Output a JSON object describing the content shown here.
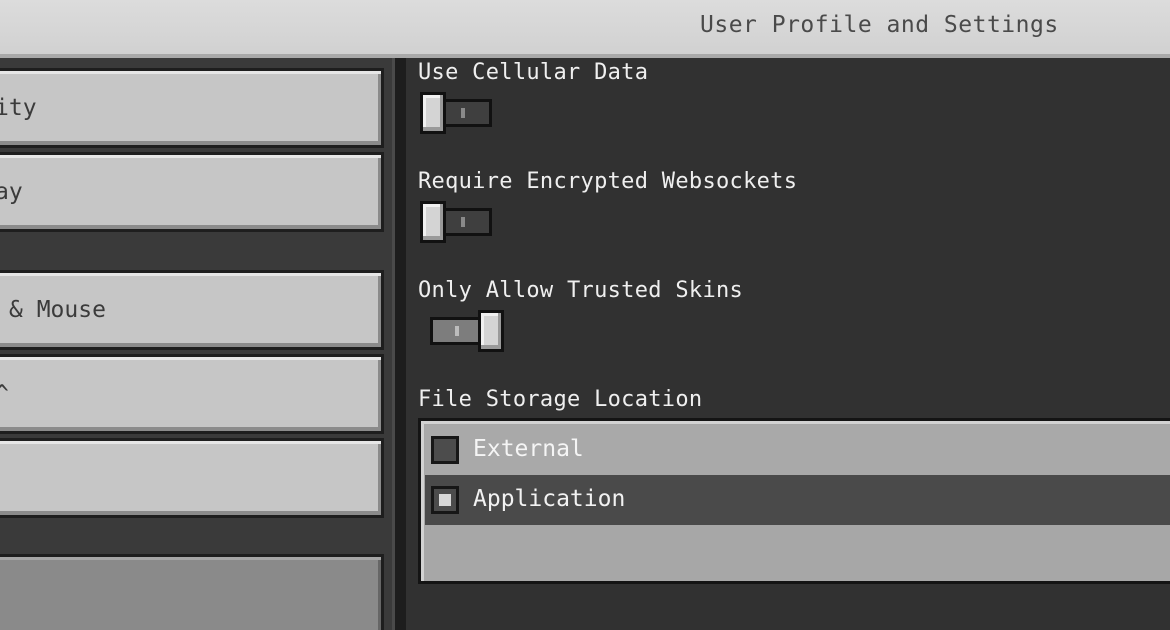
{
  "header": {
    "title": "User Profile and Settings"
  },
  "sidebar": {
    "items": [
      {
        "label": "ity"
      },
      {
        "label": "ay"
      },
      {
        "label": "& Mouse"
      },
      {
        "label": "^"
      },
      {
        "label": ""
      },
      {
        "label": ""
      }
    ]
  },
  "settings": {
    "use_cellular_data": {
      "label": "Use Cellular Data",
      "enabled": false
    },
    "require_encrypted_websockets": {
      "label": "Require Encrypted Websockets",
      "enabled": false
    },
    "only_allow_trusted_skins": {
      "label": "Only Allow Trusted Skins",
      "enabled": true
    },
    "file_storage_location": {
      "label": "File Storage Location",
      "options": [
        "External",
        "Application"
      ],
      "selected": "Application"
    }
  },
  "colors": {
    "header_bg": "#d6d6d6",
    "main_bg": "#313131",
    "button_bg": "#c6c6c6",
    "selected_row": "#4a4a4a"
  }
}
